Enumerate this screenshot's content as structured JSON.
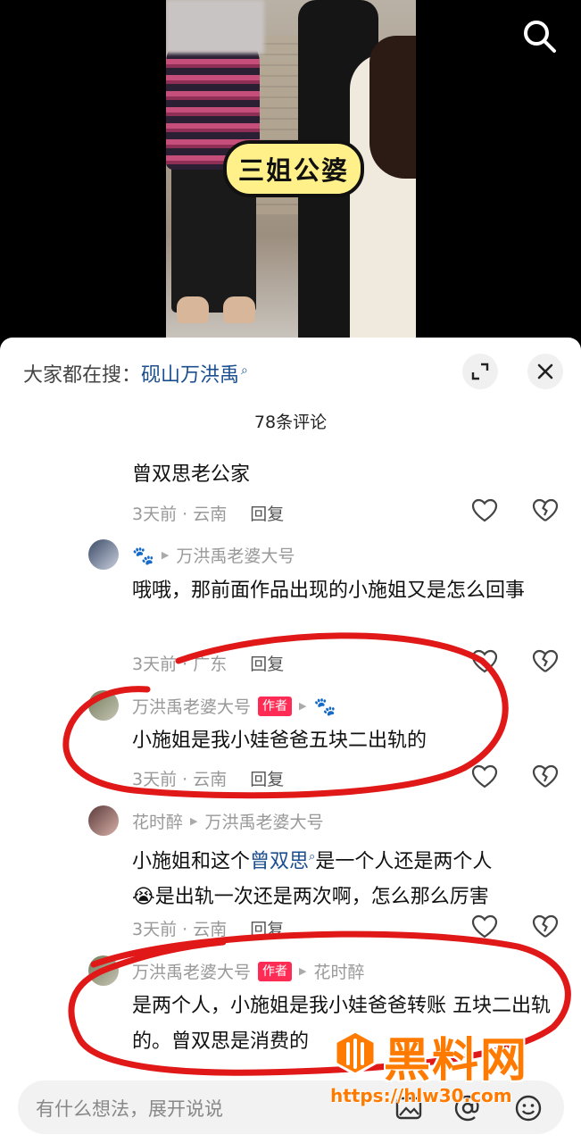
{
  "video": {
    "sticker_text": "三姐公婆"
  },
  "sheet": {
    "search_prefix": "大家都在搜：",
    "search_term": "砚山万洪禹",
    "comment_count": "78条评论"
  },
  "comments": [
    {
      "text": "曾双思老公家",
      "time": "3天前 · 云南",
      "reply_label": "回复"
    },
    {
      "user": "🐾",
      "reply_to": "万洪禹老婆大号",
      "text": "哦哦，那前面作品出现的小施姐又是怎么回事",
      "time": "3天前 · 广东",
      "reply_label": "回复"
    },
    {
      "user": "万洪禹老婆大号",
      "badge": "作者",
      "reply_to": "🐾",
      "text": "小施姐是我小娃爸爸五块二出轨的",
      "time": "3天前 · 云南",
      "reply_label": "回复"
    },
    {
      "user": "花时醉",
      "reply_to": "万洪禹老婆大号",
      "text_before_link": "小施姐和这个",
      "link": "曾双思",
      "text_after_link": "是一个人还是两个人",
      "text_line2": "😭是出轨一次还是两次啊，怎么那么厉害",
      "time": "3天前 · 云南",
      "reply_label": "回复"
    },
    {
      "user": "万洪禹老婆大号",
      "badge": "作者",
      "reply_to": "花时醉",
      "text": "是两个人，小施姐是我小娃爸爸转账 五块二出轨的。曾双思是消费的"
    }
  ],
  "input_bar": {
    "placeholder": "有什么想法，展开说说"
  },
  "watermark": {
    "title": "黑料网",
    "url": "https://hlw30.com"
  },
  "colors": {
    "link": "#1c4f8f",
    "author_badge": "#fe2c55",
    "annotation_red": "#e01818",
    "watermark": "#ff7a00"
  }
}
